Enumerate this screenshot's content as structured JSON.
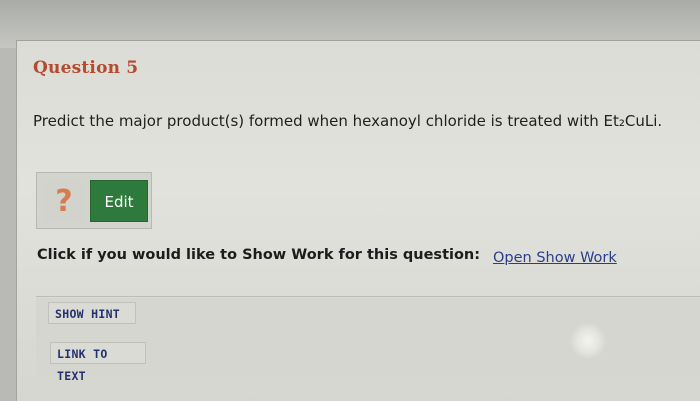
{
  "question": {
    "title": "Question 5",
    "text": "Predict the major product(s) formed when hexanoyl chloride is treated with Et₂CuLi."
  },
  "answer": {
    "placeholder_icon": "?",
    "edit_label": "Edit"
  },
  "show_work": {
    "prompt": "Click if you would like to Show Work for this question:",
    "link_label": "Open Show Work"
  },
  "actions": {
    "show_hint": "SHOW HINT",
    "link_to_text": "LINK TO TEXT"
  },
  "colors": {
    "title": "#b44a2e",
    "edit_button": "#2e7a3c",
    "link": "#2a3d8c"
  }
}
